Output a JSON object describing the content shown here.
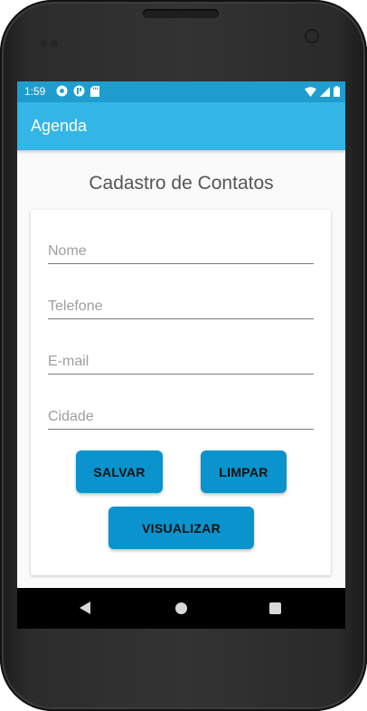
{
  "status_bar": {
    "time": "1:59",
    "left_icons": [
      "settings-icon",
      "play-protect-icon",
      "sd-card-icon"
    ],
    "right_icons": [
      "wifi-icon",
      "signal-icon",
      "battery-icon"
    ],
    "color": "#1e9dce"
  },
  "app_bar": {
    "title": "Agenda",
    "color": "#33b5e5"
  },
  "main": {
    "page_title": "Cadastro de Contatos"
  },
  "form": {
    "fields": [
      {
        "name": "nome",
        "placeholder": "Nome",
        "value": ""
      },
      {
        "name": "telefone",
        "placeholder": "Telefone",
        "value": ""
      },
      {
        "name": "email",
        "placeholder": "E-mail",
        "value": ""
      },
      {
        "name": "cidade",
        "placeholder": "Cidade",
        "value": ""
      }
    ],
    "buttons": {
      "save": "SALVAR",
      "clear": "LIMPAR",
      "view": "VISUALIZAR"
    },
    "button_color": "#0a93cc"
  },
  "nav_bar": {
    "icons": [
      "back-icon",
      "home-icon",
      "recents-icon"
    ]
  }
}
